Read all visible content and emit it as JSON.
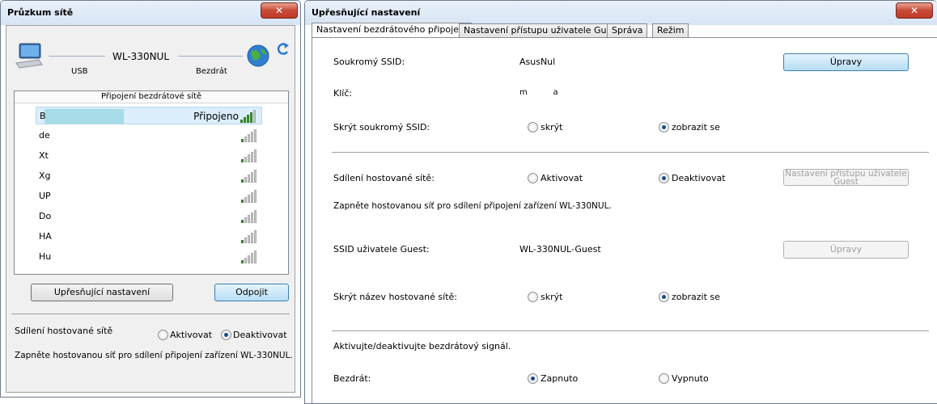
{
  "left_window": {
    "title": "Průzkum sítě",
    "close_glyph": "✕",
    "device_name": "WL-330NUL",
    "usb_label": "USB",
    "wireless_label": "Bezdrát",
    "list_header": "Připojení bezdrátové sítě",
    "networks": [
      {
        "name": "B",
        "status": "Připojeno",
        "signal": 4,
        "selected": true
      },
      {
        "name": "de",
        "status": "",
        "signal": 1
      },
      {
        "name": "Xt",
        "status": "",
        "signal": 1
      },
      {
        "name": "Xg",
        "status": "",
        "signal": 1
      },
      {
        "name": "UP",
        "status": "",
        "signal": 1
      },
      {
        "name": "Do",
        "status": "",
        "signal": 1
      },
      {
        "name": "HA",
        "status": "",
        "signal": 1
      },
      {
        "name": "Hu",
        "status": "",
        "signal": 1
      }
    ],
    "advanced_button": "Upřesňující nastavení",
    "disconnect_button": "Odpojit",
    "hosted_label": "Sdílení hostované sítě",
    "activate_label": "Aktivovat",
    "deactivate_label": "Deaktivovat",
    "note": "Zapněte hostovanou síť pro sdílení připojení zařízení WL-330NUL."
  },
  "right_window": {
    "title": "Upřesňující nastavení",
    "close_glyph": "✕",
    "tabs": [
      {
        "label": "Nastavení bezdrátového připojení",
        "active": true
      },
      {
        "label": "Nastavení přístupu uživatele Guest",
        "active": false
      },
      {
        "label": "Správa",
        "active": false
      },
      {
        "label": "Režim",
        "active": false
      }
    ],
    "ssid_label": "Soukromý SSID:",
    "ssid_value": "AsusNul",
    "edit_button": "Úpravy",
    "key_label": "Klíč:",
    "key_value": "m          a",
    "hide_ssid_label": "Skrýt soukromý SSID:",
    "hide_option": "skrýt",
    "show_option": "zobrazit se",
    "hosted_label": "Sdílení hostované sítě:",
    "activate_option": "Aktivovat",
    "deactivate_option": "Deaktivovat",
    "guest_access_button": "Nastavení přístupu uživatele Guest",
    "hosted_note": "Zapněte hostovanou síť pro sdílení připojení zařízení WL-330NUL.",
    "guest_ssid_label": "SSID uživatele Guest:",
    "guest_ssid_value": "WL-330NUL-Guest",
    "guest_edit_button": "Úpravy",
    "hide_hosted_label": "Skrýt název hostované sítě:",
    "hide_option2": "skrýt",
    "show_option2": "zobrazit se",
    "signal_note": "Aktivujte/deaktivujte bezdrátový signál.",
    "wireless_label": "Bezdrát:",
    "on_option": "Zapnuto",
    "off_option": "Vypnuto"
  }
}
